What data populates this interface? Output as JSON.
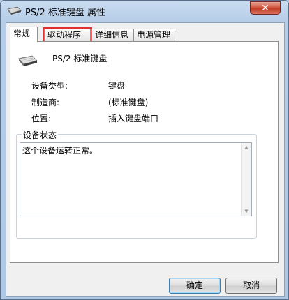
{
  "window": {
    "title": "PS/2 标准键盘 属性",
    "close_label": "✕"
  },
  "tabs": [
    {
      "label": "常规"
    },
    {
      "label": "驱动程序"
    },
    {
      "label": "详细信息"
    },
    {
      "label": "电源管理"
    }
  ],
  "device": {
    "name": "PS/2 标准键盘",
    "icon": "keyboard-icon"
  },
  "properties": [
    {
      "label": "设备类型:",
      "value": "键盘"
    },
    {
      "label": "制造商:",
      "value": "(标准键盘)"
    },
    {
      "label": "位置:",
      "value": "插入键盘端口"
    }
  ],
  "status": {
    "group_label": "设备状态",
    "text": "这个设备运转正常。"
  },
  "buttons": {
    "ok": "确定",
    "cancel": "取消"
  },
  "colors": {
    "highlight": "#e03030",
    "title_bar": "#b6cde8",
    "close": "#c23b25"
  }
}
